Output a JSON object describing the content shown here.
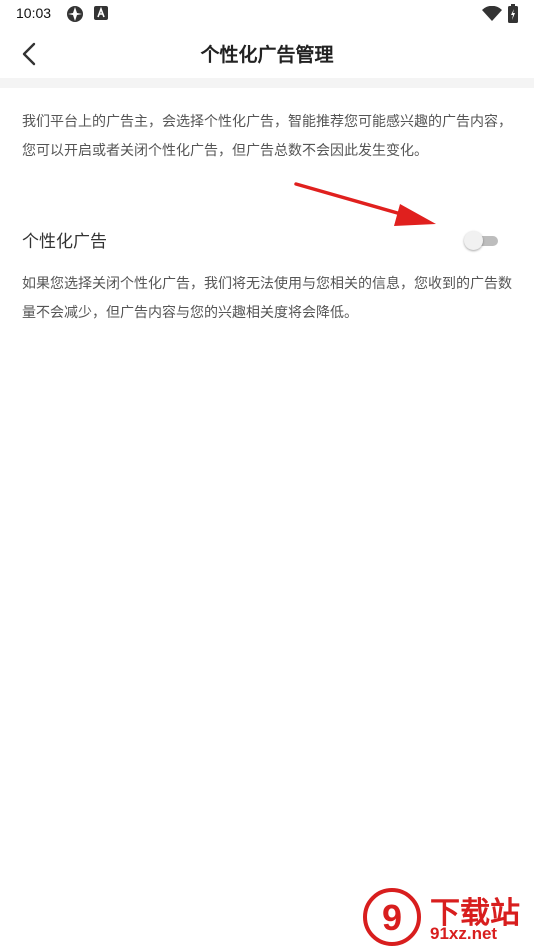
{
  "status_bar": {
    "time": "10:03",
    "icons": [
      "app-notification-icon",
      "a-notification-icon",
      "wifi-icon",
      "battery-icon"
    ]
  },
  "app_bar": {
    "back_icon": "chevron-left-icon",
    "title": "个性化广告管理"
  },
  "content": {
    "intro": "我们平台上的广告主，会选择个性化广告，智能推荐您可能感兴趣的广告内容，您可以开启或者关闭个性化广告，但广告总数不会因此发生变化。",
    "setting": {
      "label": "个性化广告",
      "enabled": false
    },
    "note": "如果您选择关闭个性化广告，我们将无法使用与您相关的信息，您收到的广告数量不会减少，但广告内容与您的兴趣相关度将会降低。"
  },
  "annotation": {
    "arrow_color": "#e0201e"
  },
  "watermark": {
    "logo_text": "9",
    "brand": "下载站",
    "url": "91xz.net",
    "color": "#d81e1e"
  }
}
